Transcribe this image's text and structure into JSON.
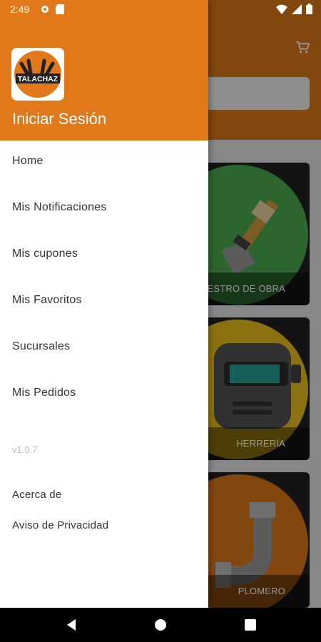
{
  "status_bar": {
    "time": "2:49",
    "left_icons": [
      "gear-icon",
      "sd-card-icon"
    ],
    "right_icons": [
      "wifi-icon",
      "cell-signal-icon",
      "battery-icon"
    ]
  },
  "background": {
    "categories": [
      {
        "label": "MAESTRO DE OBRA",
        "icon": "shovel-icon",
        "color": "#4caf50"
      },
      {
        "label": "HERRERÍA",
        "icon": "welding-mask-icon",
        "color": "#f2c31d"
      },
      {
        "label": "PLOMERO",
        "icon": "pipe-icon",
        "color": "#e1791b"
      }
    ],
    "cart_icon": "cart-icon"
  },
  "drawer": {
    "logo_text": "TALACHAZ",
    "login_label": "Iniciar Sesión",
    "menu": [
      "Home",
      "Mis Notificaciones",
      "Mis cupones",
      "Mis Favoritos",
      "Sucursales",
      "Mis Pedidos"
    ],
    "version": "v1.0.7",
    "footer_links": [
      "Acerca de",
      "Aviso de Privacidad"
    ]
  },
  "nav_bar": {
    "buttons": [
      "back-icon",
      "home-icon",
      "recents-icon"
    ]
  },
  "colors": {
    "accent": "#e1791b",
    "drawer_bg": "#ffffff",
    "text": "#333333"
  }
}
